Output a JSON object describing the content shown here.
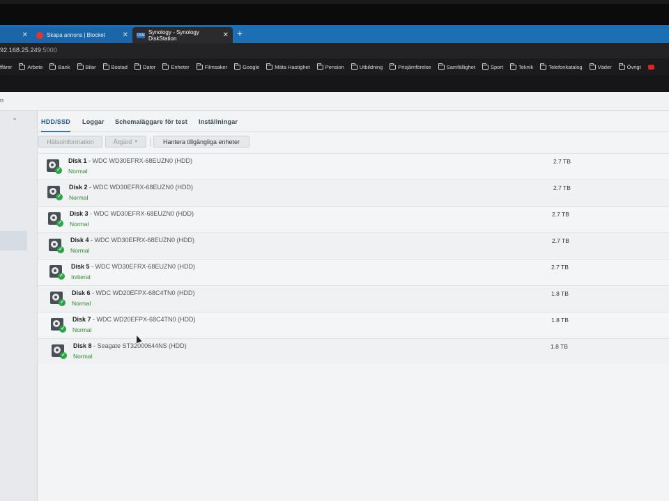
{
  "browser": {
    "tabs": [
      {
        "label": "",
        "favicon": "blank-tab-icon",
        "state": "inactive"
      },
      {
        "label": "Skapa annons | Blocket",
        "favicon": "blocket-icon",
        "state": "inactive"
      },
      {
        "label": "Synology - Synology DiskStation",
        "favicon": "synology-icon",
        "state": "active"
      }
    ],
    "address": {
      "host": "92.168.25.249",
      "port": ":5000"
    },
    "bookmarks": [
      "ffärer",
      "Arbete",
      "Bank",
      "Bilar",
      "Bostad",
      "Dator",
      "Enheter",
      "Filmsaker",
      "Google",
      "Mäta Hastighet",
      "Pension",
      "Utbildning",
      "Prisjämförelse",
      "Samfällighet",
      "Sport",
      "Teknik",
      "Telefonkatalog",
      "Väder",
      "Övrigt"
    ]
  },
  "window": {
    "title_fragment": "n"
  },
  "tabs": [
    "HDD/SSD",
    "Loggar",
    "Schemaläggare för test",
    "Inställningar"
  ],
  "toolbar": {
    "health_label": "Hälsoinformation",
    "action_label": "Åtgärd",
    "manage_label": "Hantera tillgängliga enheter"
  },
  "disks": [
    {
      "name": "Disk 1",
      "model": " - WDC WD30EFRX-68EUZN0 (HDD)",
      "status": "Normal",
      "capacity": "2.7 TB"
    },
    {
      "name": "Disk 2",
      "model": " - WDC WD30EFRX-68EUZN0 (HDD)",
      "status": "Normal",
      "capacity": "2.7 TB"
    },
    {
      "name": "Disk 3",
      "model": " - WDC WD30EFRX-68EUZN0 (HDD)",
      "status": "Normal",
      "capacity": "2.7 TB"
    },
    {
      "name": "Disk 4",
      "model": " - WDC WD30EFRX-68EUZN0 (HDD)",
      "status": "Normal",
      "capacity": "2.7 TB"
    },
    {
      "name": "Disk 5",
      "model": " - WDC WD30EFRX-68EUZN0 (HDD)",
      "status": "Initierat",
      "capacity": "2.7 TB"
    },
    {
      "name": "Disk 6",
      "model": " - WDC WD20EFPX-68C4TN0 (HDD)",
      "status": "Normal",
      "capacity": "1.8 TB"
    },
    {
      "name": "Disk 7",
      "model": " - WDC WD20EFPX-68C4TN0 (HDD)",
      "status": "Normal",
      "capacity": "1.8 TB"
    },
    {
      "name": "Disk 8",
      "model": " - Seagate ST32000644NS (HDD)",
      "status": "Normal",
      "capacity": "1.8 TB"
    }
  ],
  "colors": {
    "status_ok": "#2f8a2f",
    "accent": "#2d76c4",
    "tabbar": "#1c6fb3"
  }
}
